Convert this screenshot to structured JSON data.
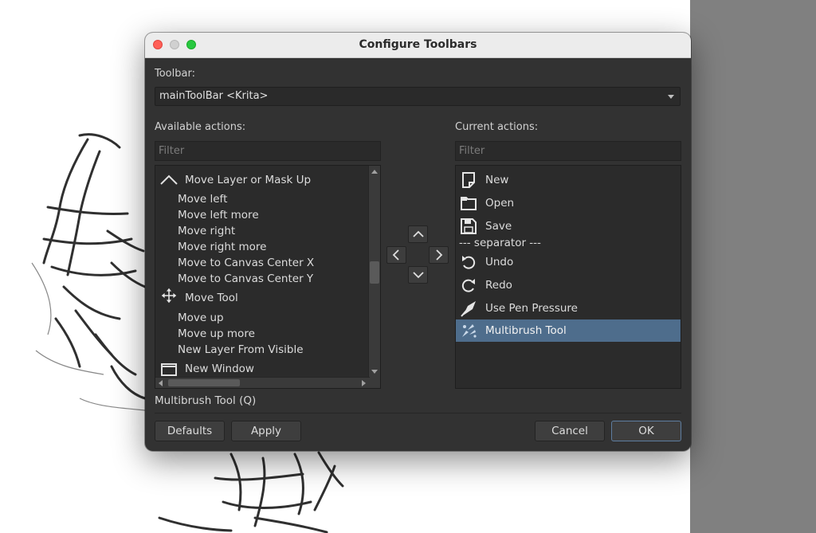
{
  "dialog": {
    "title": "Configure Toolbars"
  },
  "toolbar": {
    "label": "Toolbar:",
    "selected": "mainToolBar <Krita>"
  },
  "available": {
    "label": "Available actions:",
    "filter_placeholder": "Filter",
    "items": [
      {
        "label": "Move Layer or Mask Up",
        "icon": "chevron-up-icon"
      },
      {
        "label": "Move left",
        "icon": ""
      },
      {
        "label": "Move left more",
        "icon": ""
      },
      {
        "label": "Move right",
        "icon": ""
      },
      {
        "label": "Move right more",
        "icon": ""
      },
      {
        "label": "Move to Canvas Center X",
        "icon": ""
      },
      {
        "label": "Move to Canvas Center Y",
        "icon": ""
      },
      {
        "label": "Move Tool",
        "icon": "move-arrows-icon"
      },
      {
        "label": "Move up",
        "icon": ""
      },
      {
        "label": "Move up more",
        "icon": ""
      },
      {
        "label": "New Layer From Visible",
        "icon": ""
      },
      {
        "label": "New Window",
        "icon": "window-icon"
      }
    ]
  },
  "current": {
    "label": "Current actions:",
    "filter_placeholder": "Filter",
    "items": [
      {
        "label": "New",
        "icon": "new-document-icon"
      },
      {
        "label": "Open",
        "icon": "folder-icon"
      },
      {
        "label": "Save",
        "icon": "save-icon"
      },
      {
        "label": "--- separator ---",
        "icon": ""
      },
      {
        "label": "Undo",
        "icon": "undo-icon"
      },
      {
        "label": "Redo",
        "icon": "redo-icon"
      },
      {
        "label": "Use Pen Pressure",
        "icon": "pen-pressure-icon"
      },
      {
        "label": "Multibrush Tool",
        "icon": "multibrush-icon",
        "selected": true
      }
    ]
  },
  "status": {
    "text": "Multibrush Tool (Q)"
  },
  "buttons": {
    "defaults": "Defaults",
    "apply": "Apply",
    "cancel": "Cancel",
    "ok": "OK"
  },
  "colors": {
    "dialog_bg": "#323232",
    "selection": "#4e6d8c",
    "close": "#ff5f57",
    "maximize": "#28c840"
  }
}
